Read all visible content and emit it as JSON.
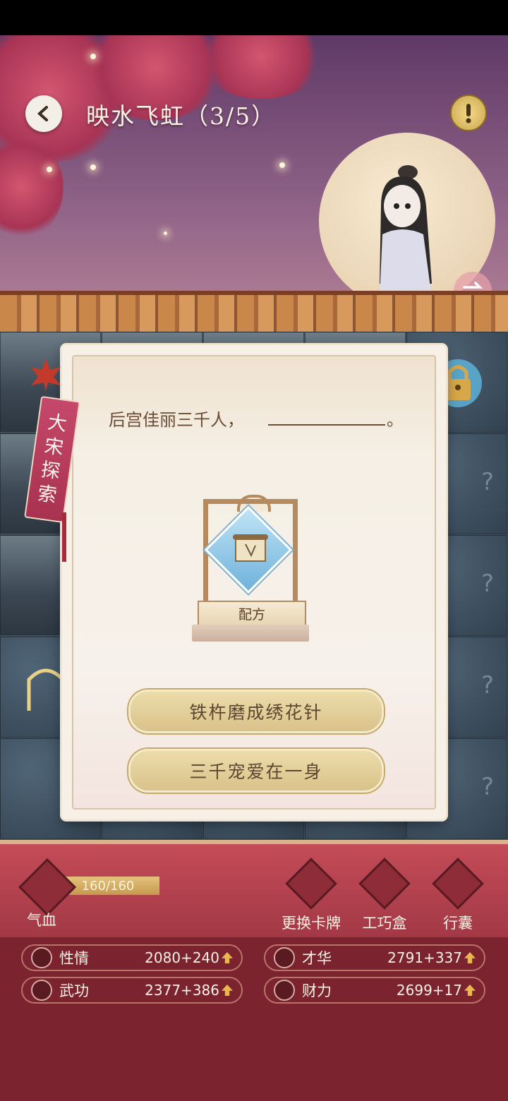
{
  "header": {
    "title": "映水飞虹（3/5）"
  },
  "panel": {
    "question": "后宫佳丽三千人，",
    "question_end": "。",
    "reward_label": "配方",
    "answers": [
      "铁杵磨成绣花针",
      "三千宠爱在一身"
    ]
  },
  "side_tag": {
    "chars": [
      "大",
      "宋",
      "探",
      "索"
    ]
  },
  "player": {
    "hp_text": "160/160",
    "hp_label": "气血"
  },
  "actions": [
    {
      "label": "更换卡牌",
      "icon": "cards-icon"
    },
    {
      "label": "工巧盒",
      "icon": "scissors-icon"
    },
    {
      "label": "行囊",
      "icon": "bag-icon"
    }
  ],
  "stats": [
    {
      "name": "性情",
      "value": "2080+240",
      "icon": "flower-icon"
    },
    {
      "name": "才华",
      "value": "2791+337",
      "icon": "fan-icon"
    },
    {
      "name": "武功",
      "value": "2377+386",
      "icon": "sword-icon"
    },
    {
      "name": "财力",
      "value": "2699+17",
      "icon": "coin-icon"
    }
  ],
  "colors": {
    "accent_gold": "#d9c28a",
    "bottom_red": "#7b2430",
    "text_brown": "#6b4d36"
  }
}
